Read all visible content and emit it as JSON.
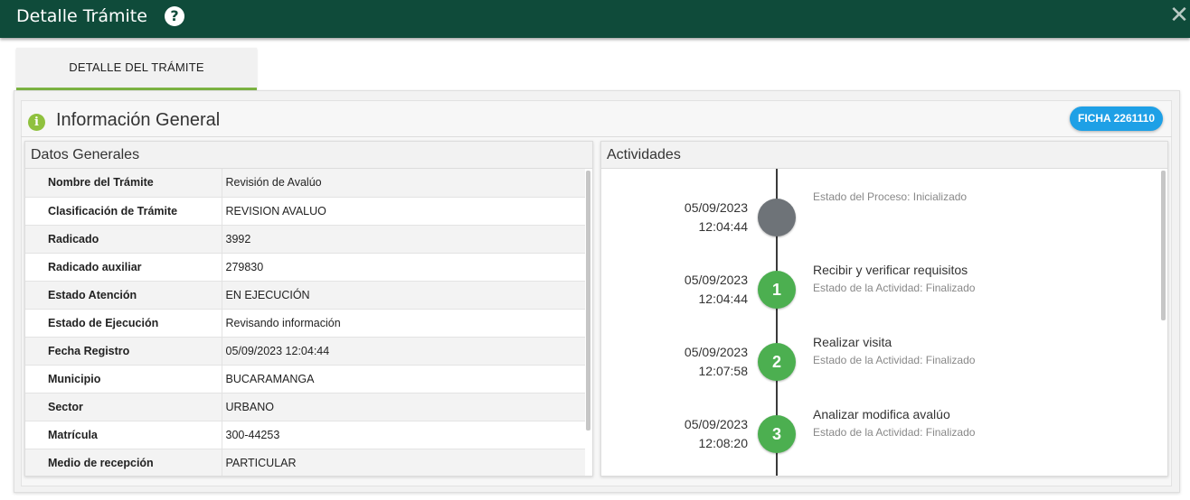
{
  "window": {
    "title": "Detalle Trámite",
    "help": "?",
    "close": "✕"
  },
  "tab": {
    "label": "DETALLE DEL TRÁMITE"
  },
  "section": {
    "icon": "i",
    "title": "Información General",
    "badge": "FICHA 2261110"
  },
  "datos": {
    "title": "Datos Generales",
    "rows": [
      {
        "label": "Nombre del Trámite",
        "value": "Revisión de Avalúo"
      },
      {
        "label": "Clasificación de Trámite",
        "value": "REVISION AVALUO"
      },
      {
        "label": "Radicado",
        "value": "3992"
      },
      {
        "label": "Radicado auxiliar",
        "value": "279830"
      },
      {
        "label": "Estado Atención",
        "value": "EN EJECUCIÓN"
      },
      {
        "label": "Estado de Ejecución",
        "value": "Revisando información"
      },
      {
        "label": "Fecha Registro",
        "value": "05/09/2023 12:04:44"
      },
      {
        "label": "Municipio",
        "value": "BUCARAMANGA"
      },
      {
        "label": "Sector",
        "value": "URBANO"
      },
      {
        "label": "Matrícula",
        "value": "300-44253"
      },
      {
        "label": "Medio de recepción",
        "value": "PARTICULAR"
      }
    ]
  },
  "actividades": {
    "title": "Actividades",
    "items": [
      {
        "date": "05/09/2023",
        "time": "12:04:44",
        "number": "",
        "title": "",
        "status": "Estado del Proceso: Inicializado"
      },
      {
        "date": "05/09/2023",
        "time": "12:04:44",
        "number": "1",
        "title": "Recibir y verificar requisitos",
        "status": "Estado de la Actividad: Finalizado"
      },
      {
        "date": "05/09/2023",
        "time": "12:07:58",
        "number": "2",
        "title": "Realizar visita",
        "status": "Estado de la Actividad: Finalizado"
      },
      {
        "date": "05/09/2023",
        "time": "12:08:20",
        "number": "3",
        "title": "Analizar modifica avalúo",
        "status": "Estado de la Actividad: Finalizado"
      }
    ]
  }
}
